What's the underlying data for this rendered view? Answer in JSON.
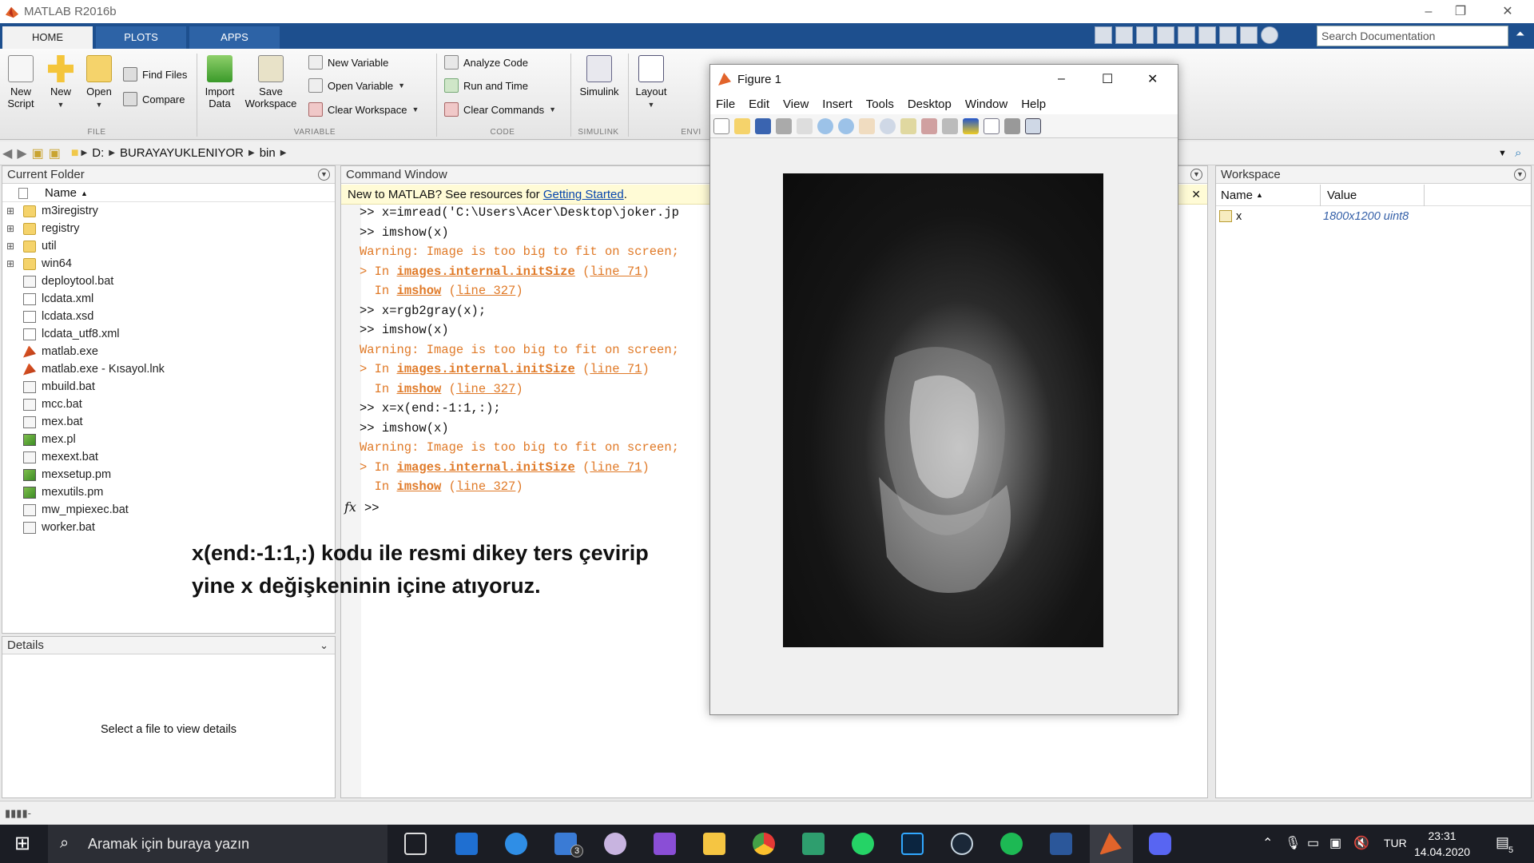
{
  "window": {
    "title": "MATLAB R2016b"
  },
  "ribbon_tabs": [
    "HOME",
    "PLOTS",
    "APPS"
  ],
  "search": {
    "placeholder": "Search Documentation"
  },
  "ribbon": {
    "new_script": "New Script",
    "new": "New",
    "open": "Open",
    "find_files": "Find Files",
    "compare": "Compare",
    "import_data": "Import Data",
    "save_workspace": "Save Workspace",
    "new_variable": "New Variable",
    "open_variable": "Open Variable",
    "clear_workspace": "Clear Workspace",
    "analyze_code": "Analyze Code",
    "run_and_time": "Run and Time",
    "clear_commands": "Clear Commands",
    "simulink": "Simulink",
    "layout": "Layout",
    "groups": {
      "file": "FILE",
      "variable": "VARIABLE",
      "code": "CODE",
      "simulink": "SIMULINK",
      "env": "ENVI"
    }
  },
  "address": {
    "crumbs": [
      "D:",
      "BURAYAYUKLENIYOR",
      "bin"
    ]
  },
  "current_folder": {
    "title": "Current Folder",
    "column": "Name",
    "items": [
      {
        "name": "m3iregistry",
        "kind": "folder"
      },
      {
        "name": "registry",
        "kind": "folder"
      },
      {
        "name": "util",
        "kind": "folder"
      },
      {
        "name": "win64",
        "kind": "folder"
      },
      {
        "name": "deploytool.bat",
        "kind": "bat"
      },
      {
        "name": "lcdata.xml",
        "kind": "xml"
      },
      {
        "name": "lcdata.xsd",
        "kind": "xsd"
      },
      {
        "name": "lcdata_utf8.xml",
        "kind": "xml"
      },
      {
        "name": "matlab.exe",
        "kind": "exe"
      },
      {
        "name": "matlab.exe - Kısayol.lnk",
        "kind": "exe"
      },
      {
        "name": "mbuild.bat",
        "kind": "bat"
      },
      {
        "name": "mcc.bat",
        "kind": "bat"
      },
      {
        "name": "mex.bat",
        "kind": "bat"
      },
      {
        "name": "mex.pl",
        "kind": "pl"
      },
      {
        "name": "mexext.bat",
        "kind": "bat"
      },
      {
        "name": "mexsetup.pm",
        "kind": "pl"
      },
      {
        "name": "mexutils.pm",
        "kind": "pl"
      },
      {
        "name": "mw_mpiexec.bat",
        "kind": "bat"
      },
      {
        "name": "worker.bat",
        "kind": "bat"
      }
    ]
  },
  "details": {
    "title": "Details",
    "message": "Select a file to view details"
  },
  "command_window": {
    "title": "Command Window",
    "banner_prefix": "New to MATLAB? See resources for ",
    "banner_link": "Getting Started",
    "banner_suffix": ".",
    "prompt": ">>",
    "fx": "fx",
    "lines": [
      {
        "type": "cmd",
        "text": ">> x=imread('C:\\Users\\Acer\\Desktop\\joker.jp"
      },
      {
        "type": "cmd",
        "text": ">> imshow(x)"
      },
      {
        "type": "warn",
        "text": "Warning: Image is too big to fit on screen;"
      },
      {
        "type": "trace1",
        "pre": "> In ",
        "fn": "images.internal.initSize",
        "mid": " (",
        "line": "line 71",
        "post": ")"
      },
      {
        "type": "trace2",
        "pre": "  In ",
        "fn": "imshow",
        "mid": " (",
        "line": "line 327",
        "post": ")"
      },
      {
        "type": "cmd",
        "text": ">> x=rgb2gray(x);"
      },
      {
        "type": "cmd",
        "text": ">> imshow(x)"
      },
      {
        "type": "warn",
        "text": "Warning: Image is too big to fit on screen;"
      },
      {
        "type": "trace1",
        "pre": "> In ",
        "fn": "images.internal.initSize",
        "mid": " (",
        "line": "line 71",
        "post": ")"
      },
      {
        "type": "trace2",
        "pre": "  In ",
        "fn": "imshow",
        "mid": " (",
        "line": "line 327",
        "post": ")"
      },
      {
        "type": "cmd",
        "text": ">> x=x(end:-1:1,:);"
      },
      {
        "type": "cmd",
        "text": ">> imshow(x)"
      },
      {
        "type": "warn",
        "text": "Warning: Image is too big to fit on screen;"
      },
      {
        "type": "trace1",
        "pre": "> In ",
        "fn": "images.internal.initSize",
        "mid": " (",
        "line": "line 71",
        "post": ")"
      },
      {
        "type": "trace2",
        "pre": "  In ",
        "fn": "imshow",
        "mid": " (",
        "line": "line 327",
        "post": ")"
      }
    ]
  },
  "workspace": {
    "title": "Workspace",
    "col_name": "Name",
    "col_value": "Value",
    "rows": [
      {
        "name": "x",
        "value": "1800x1200 uint8"
      }
    ]
  },
  "figure": {
    "title": "Figure 1",
    "menu": [
      "File",
      "Edit",
      "View",
      "Insert",
      "Tools",
      "Desktop",
      "Window",
      "Help"
    ]
  },
  "annotation": {
    "line1": "x(end:-1:1,:) kodu ile resmi dikey ters çevirip",
    "line2": "yine x değişkeninin içine atıyoruz."
  },
  "taskbar": {
    "search_placeholder": "Aramak için buraya yazın",
    "lang": "TUR",
    "time": "23:31",
    "date": "14.04.2020",
    "mail_badge": "3",
    "notif_badge": "5"
  }
}
